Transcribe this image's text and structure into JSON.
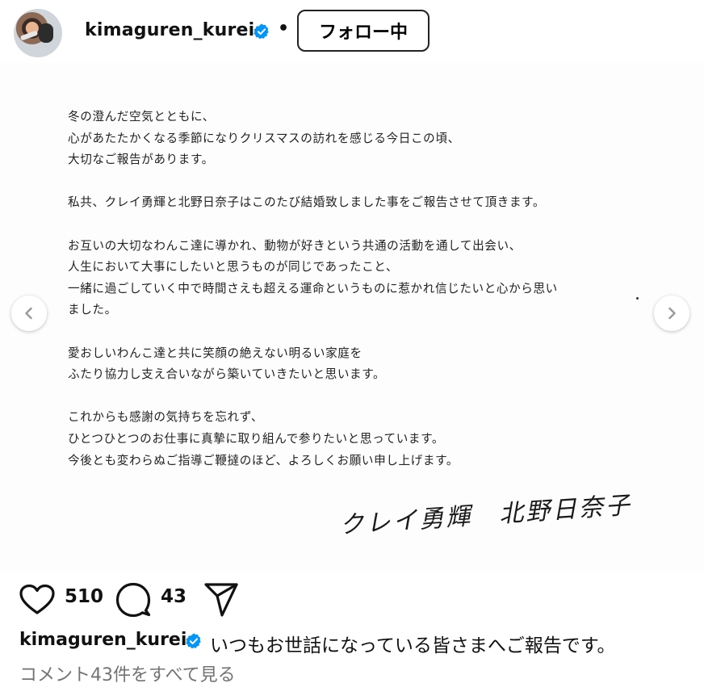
{
  "header": {
    "username": "kimaguren_kurei",
    "separator": "•",
    "follow_label": "フォロー中"
  },
  "letter": {
    "lines": [
      "冬の澄んだ空気とともに、",
      "心があたたかくなる季節になりクリスマスの訪れを感じる今日この頃、",
      "大切なご報告があります。",
      "",
      "私共、クレイ勇輝と北野日奈子はこのたび結婚致しました事をご報告させて頂きます。",
      "",
      "お互いの大切なわんこ達に導かれ、動物が好きという共通の活動を通して出会い、",
      "人生において大事にしたいと思うものが同じであったこと、",
      "一緒に過ごしていく中で時間さえも超える運命というものに惹かれ信じたいと心から思い",
      "ました。",
      "",
      "愛おしいわんこ達と共に笑顔の絶えない明るい家庭を",
      "ふたり協力し支え合いながら築いていきたいと思います。",
      "",
      "これからも感謝の気持ちを忘れず、",
      "ひとつひとつのお仕事に真摯に取り組んで参りたいと思っています。",
      "今後とも変わらぬご指導ご鞭撻のほど、よろしくお願い申し上げます。"
    ],
    "signature": "クレイ勇輝　北野日奈子"
  },
  "actions": {
    "likes": "510",
    "comments": "43",
    "icons": [
      "heart-icon",
      "comment-icon",
      "share-icon"
    ]
  },
  "caption": {
    "username": "kimaguren_kurei",
    "text": "いつもお世話になっている皆さまへご報告です。"
  },
  "comments_link": "コメント43件をすべて見る",
  "colors": {
    "verified": "#0095f6",
    "muted_text": "#737373"
  }
}
